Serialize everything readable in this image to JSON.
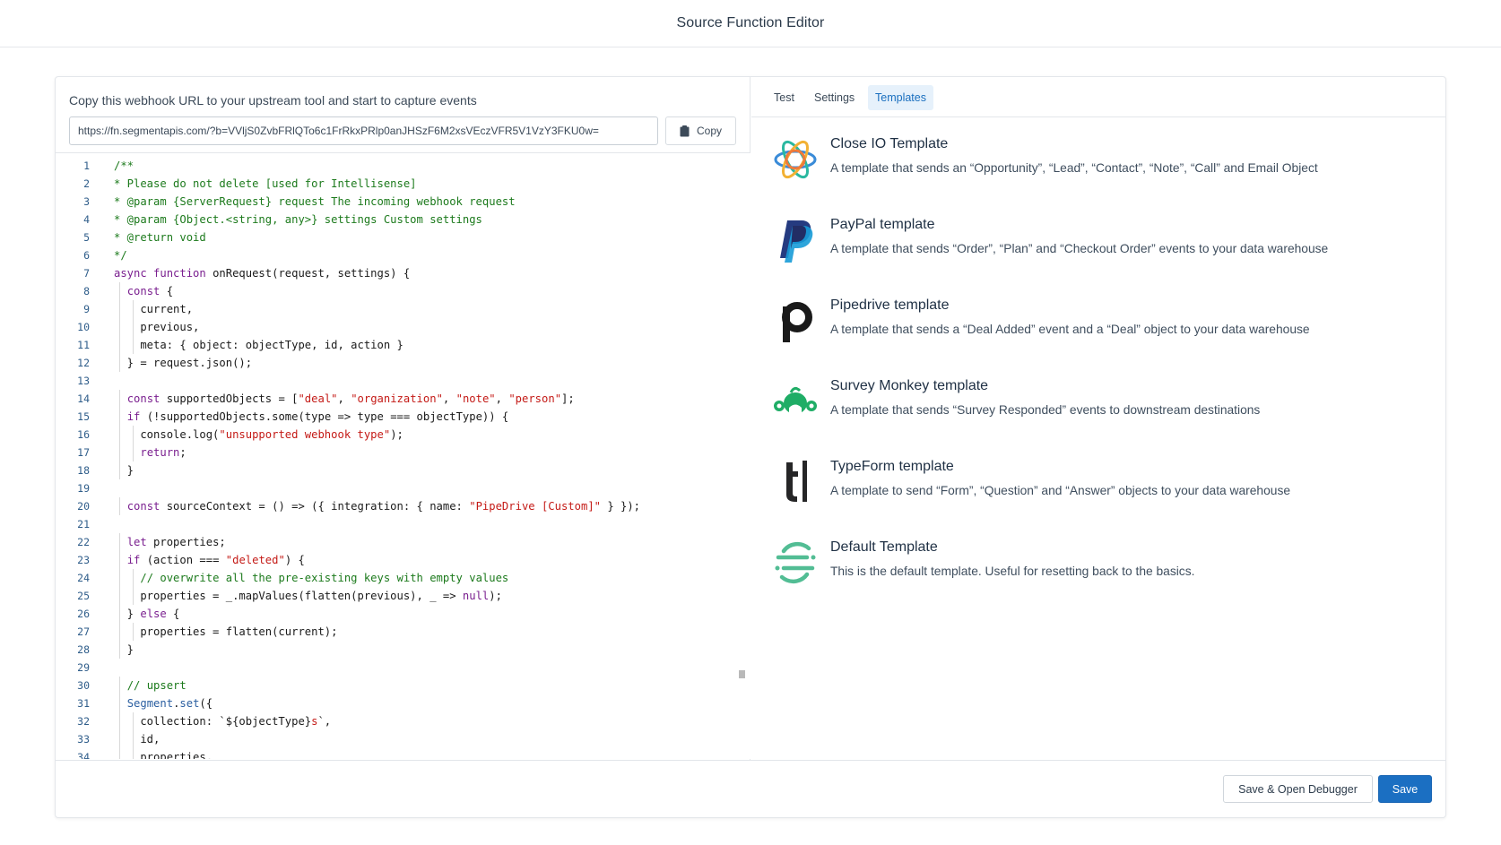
{
  "header": {
    "title": "Source Function Editor"
  },
  "webhook": {
    "label": "Copy this webhook URL to your upstream tool and start to capture events",
    "url": "https://fn.segmentapis.com/?b=VVljS0ZvbFRlQTo6c1FrRkxPRlp0anJHSzF6M2xsVEczVFR5V1VzY3FKU0w=",
    "copy_label": "Copy",
    "copy_icon": "clipboard-icon"
  },
  "code": [
    [
      [
        "c",
        "/**"
      ]
    ],
    [
      [
        "c",
        "* Please do not delete [used for Intellisense]"
      ]
    ],
    [
      [
        "c",
        "* @param {ServerRequest} request The incoming webhook request"
      ]
    ],
    [
      [
        "c",
        "* @param {Object.<string, any>} settings Custom settings"
      ]
    ],
    [
      [
        "c",
        "* @return void"
      ]
    ],
    [
      [
        "c",
        "*/"
      ]
    ],
    [
      [
        "k",
        "async"
      ],
      [
        "n",
        " "
      ],
      [
        "k",
        "function"
      ],
      [
        "n",
        " onRequest(request, settings) {"
      ]
    ],
    [
      [
        "n",
        "  "
      ],
      [
        "k",
        "const"
      ],
      [
        "n",
        " {"
      ]
    ],
    [
      [
        "n",
        "    current,"
      ]
    ],
    [
      [
        "n",
        "    previous,"
      ]
    ],
    [
      [
        "n",
        "    meta: { object: objectType, id, action }"
      ]
    ],
    [
      [
        "n",
        "  } = request.json();"
      ]
    ],
    [
      [
        "n",
        ""
      ]
    ],
    [
      [
        "n",
        "  "
      ],
      [
        "k",
        "const"
      ],
      [
        "n",
        " supportedObjects = ["
      ],
      [
        "s",
        "\"deal\""
      ],
      [
        "n",
        ", "
      ],
      [
        "s",
        "\"organization\""
      ],
      [
        "n",
        ", "
      ],
      [
        "s",
        "\"note\""
      ],
      [
        "n",
        ", "
      ],
      [
        "s",
        "\"person\""
      ],
      [
        "n",
        "];"
      ]
    ],
    [
      [
        "n",
        "  "
      ],
      [
        "k",
        "if"
      ],
      [
        "n",
        " (!supportedObjects.some(type => type === objectType)) {"
      ]
    ],
    [
      [
        "n",
        "    console.log("
      ],
      [
        "s",
        "\"unsupported webhook type\""
      ],
      [
        "n",
        ");"
      ]
    ],
    [
      [
        "n",
        "    "
      ],
      [
        "k",
        "return"
      ],
      [
        "n",
        ";"
      ]
    ],
    [
      [
        "n",
        "  }"
      ]
    ],
    [
      [
        "n",
        ""
      ]
    ],
    [
      [
        "n",
        "  "
      ],
      [
        "k",
        "const"
      ],
      [
        "n",
        " sourceContext = () => ({ integration: { name: "
      ],
      [
        "s",
        "\"PipeDrive [Custom]\""
      ],
      [
        "n",
        " } });"
      ]
    ],
    [
      [
        "n",
        ""
      ]
    ],
    [
      [
        "n",
        "  "
      ],
      [
        "k",
        "let"
      ],
      [
        "n",
        " properties;"
      ]
    ],
    [
      [
        "n",
        "  "
      ],
      [
        "k",
        "if"
      ],
      [
        "n",
        " (action === "
      ],
      [
        "s",
        "\"deleted\""
      ],
      [
        "n",
        ") {"
      ]
    ],
    [
      [
        "n",
        "    "
      ],
      [
        "c",
        "// overwrite all the pre-existing keys with empty values"
      ]
    ],
    [
      [
        "n",
        "    properties = _.mapValues(flatten(previous), _ => "
      ],
      [
        "k",
        "null"
      ],
      [
        "n",
        ");"
      ]
    ],
    [
      [
        "n",
        "  } "
      ],
      [
        "k",
        "else"
      ],
      [
        "n",
        " {"
      ]
    ],
    [
      [
        "n",
        "    properties = flatten(current);"
      ]
    ],
    [
      [
        "n",
        "  }"
      ]
    ],
    [
      [
        "n",
        ""
      ]
    ],
    [
      [
        "n",
        "  "
      ],
      [
        "c",
        "// upsert"
      ]
    ],
    [
      [
        "n",
        "  "
      ],
      [
        "p",
        "Segment"
      ],
      [
        "n",
        "."
      ],
      [
        "p",
        "set"
      ],
      [
        "n",
        "({"
      ]
    ],
    [
      [
        "n",
        "    collection: `${objectType}"
      ],
      [
        "s",
        "s"
      ],
      [
        "n",
        "`,"
      ]
    ],
    [
      [
        "n",
        "    id,"
      ]
    ],
    [
      [
        "n",
        "    properties,"
      ]
    ]
  ],
  "tabs": [
    {
      "label": "Test",
      "active": false
    },
    {
      "label": "Settings",
      "active": false
    },
    {
      "label": "Templates",
      "active": true
    }
  ],
  "templates": [
    {
      "name": "Close IO Template",
      "description": "A template that sends an “Opportunity”, “Lead”, “Contact”, “Note”, “Call” and Email Object",
      "icon": "close-io-logo-icon"
    },
    {
      "name": "PayPal template",
      "description": "A template that sends “Order”, “Plan” and “Checkout Order” events to your data warehouse",
      "icon": "paypal-logo-icon"
    },
    {
      "name": "Pipedrive template",
      "description": "A template that sends a “Deal Added” event and a “Deal” object to your data warehouse",
      "icon": "pipedrive-logo-icon"
    },
    {
      "name": "Survey Monkey template",
      "description": "A template that sends “Survey Responded” events to downstream destinations",
      "icon": "survey-monkey-logo-icon"
    },
    {
      "name": "TypeForm template",
      "description": "A template to send “Form”, “Question” and “Answer” objects to your data warehouse",
      "icon": "typeform-logo-icon"
    },
    {
      "name": "Default Template",
      "description": "This is the default template. Useful for resetting back to the basics.",
      "icon": "segment-logo-icon"
    }
  ],
  "footer": {
    "debug_label": "Save & Open Debugger",
    "save_label": "Save",
    "save_color": "#1b6fc2"
  },
  "colors": {
    "comment": "#1c7a1c",
    "keyword": "#7a1f8f",
    "string": "#c41a16",
    "line_number": "#2f5d8a",
    "active_tab_bg": "#e6f1fb",
    "active_tab_text": "#1a6fbf"
  }
}
